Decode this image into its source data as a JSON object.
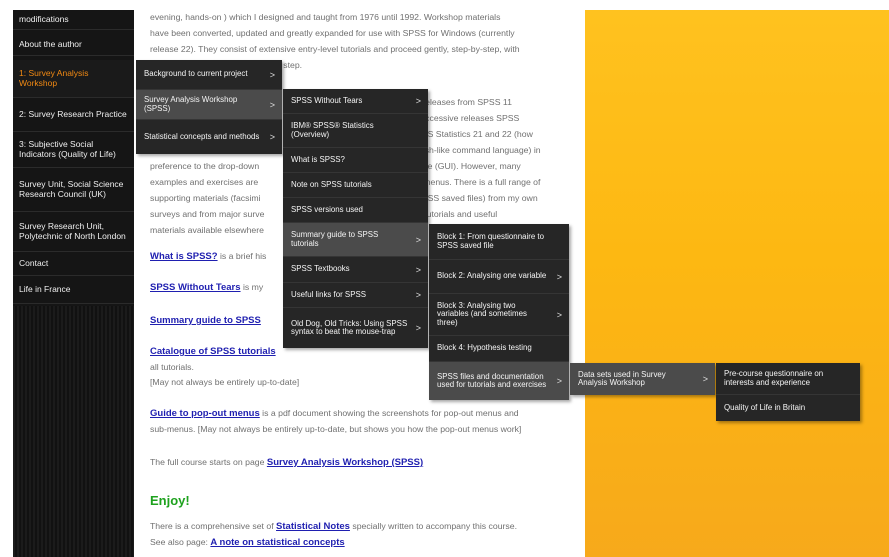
{
  "sidebar": {
    "items": [
      {
        "label": "modifications"
      },
      {
        "label": "About the author"
      },
      {
        "label": "1: Survey Analysis Workshop"
      },
      {
        "label": "2: Survey Research Practice"
      },
      {
        "label": "3: Subjective Social Indicators (Quality of Life)"
      },
      {
        "label": "Survey Unit, Social Science Research Council (UK)"
      },
      {
        "label": "Survey Research Unit, Polytechnic of North London"
      },
      {
        "label": "Contact"
      },
      {
        "label": "Life in France"
      }
    ]
  },
  "content": {
    "lines": [
      "evening, hands-on ) which I designed and taught from 1976 until 1992.  Workshop materials",
      "have been converted, updated and greatly expanded for use with SPSS for Windows (currently",
      "release 22).  They consist of extensive entry-level tutorials and proceed gently, step-by-step, with",
      "n step.",
      "ll releases from SPSS 11",
      "successive releases SPSS",
      "PSS Statistics 21 and 22 (how",
      "glish-like command language) in",
      "preference to the drop-down",
      "face (GUI). However, many",
      "examples and exercises are",
      "n menus. There is a full range of",
      "supporting materials (facsimi",
      "SPSS saved files) from my own",
      "surveys and from major surve",
      "S tutorials and useful",
      "materials available elsewhere"
    ],
    "links": {
      "what_is": "What is SPSS?",
      "what_is_rest": " is a brief his",
      "without_tears": "SPSS Without Tears",
      "without_tears_rest": " is my",
      "summary": "Summary guide to SPSS",
      "catalogue": "Catalogue of SPSS tutorials",
      "all_tutorials": "all tutorials.",
      "may_not": "[May not always be entirely up-to-date]",
      "guide": "Guide to pop-out menus",
      "guide_rest": " is a pdf document showing the screenshots for pop-out menus and",
      "guide_line2": "sub-menus. [May not always be entirely up-to-date, but shows you how the pop-out menus work]",
      "course_pre": "The full course starts on page ",
      "course_link": "Survey Analysis Workshop (SPSS)",
      "enjoy": "Enjoy!",
      "stat_pre": "There is a comprehensive set of ",
      "stat_link": "Statistical Notes",
      "stat_rest": " specially written to accompany this course.",
      "see_pre": "See also page: ",
      "see_link": "A note on statistical concepts"
    }
  },
  "menus": {
    "level1": [
      {
        "label": "Background to current project"
      },
      {
        "label": "Survey Analysis Workshop (SPSS)"
      },
      {
        "label": "Statistical concepts and methods"
      }
    ],
    "level2": [
      {
        "label": "SPSS Without Tears"
      },
      {
        "label": "IBM® SPSS® Statistics (Overview)"
      },
      {
        "label": "What is SPSS?"
      },
      {
        "label": "Note on SPSS tutorials"
      },
      {
        "label": "SPSS versions used"
      },
      {
        "label": "Summary guide to SPSS tutorials"
      },
      {
        "label": "SPSS Textbooks"
      },
      {
        "label": "Useful links for SPSS"
      },
      {
        "label": "Old Dog, Old Tricks: Using SPSS syntax to beat the mouse-trap"
      }
    ],
    "level3": [
      {
        "label": "Block 1: From questionnaire to SPSS saved file"
      },
      {
        "label": "Block 2: Analysing one variable"
      },
      {
        "label": "Block 3: Analysing two variables (and sometimes three)"
      },
      {
        "label": "Block 4: Hypothesis testing"
      },
      {
        "label": "SPSS files and documentation used for tutorials and exercises"
      }
    ],
    "level4": [
      {
        "label": "Data sets used in Survey Analysis Workshop"
      }
    ],
    "level5": [
      {
        "label": "Pre-course questionnaire on interests and experience"
      },
      {
        "label": "Quality of Life in Britain"
      }
    ],
    "arrow_glyph": ">"
  }
}
